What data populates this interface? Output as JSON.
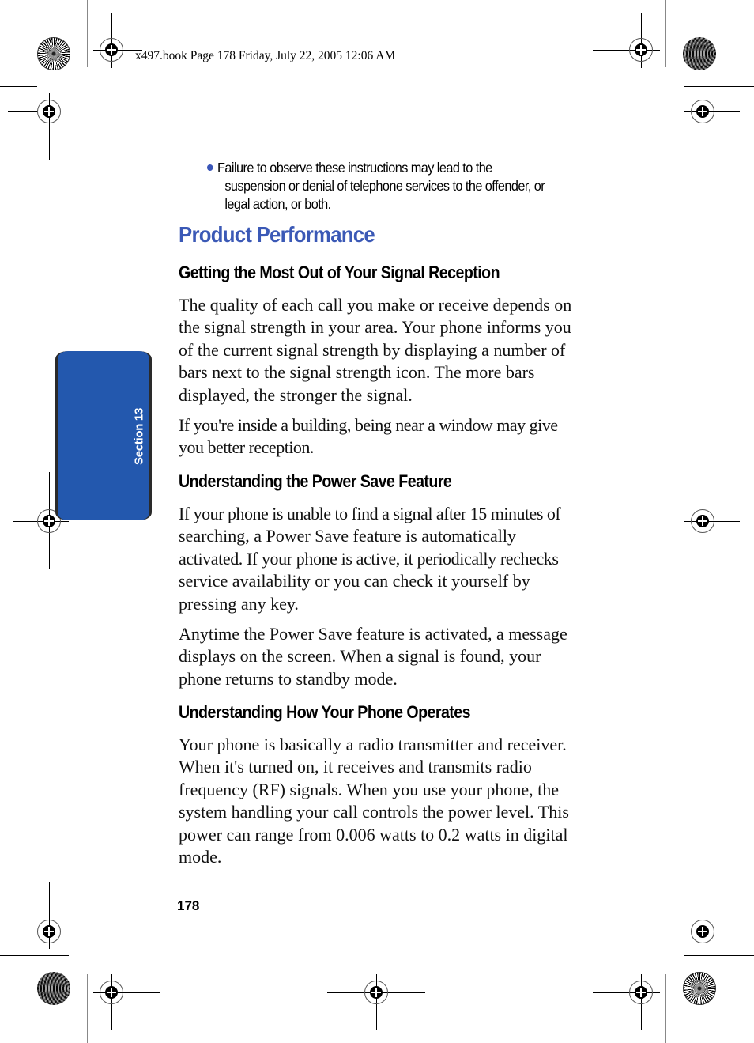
{
  "header": {
    "slug": "x497.book  Page 178  Friday, July 22, 2005  12:06 AM"
  },
  "section_tab": {
    "label": "Section 13",
    "color": "#2358ae"
  },
  "bullet": {
    "color": "#3a56b8",
    "lines": [
      "Failure to observe these instructions may lead to the",
      "suspension or denial of telephone services to the offender, or",
      "legal action, or both."
    ]
  },
  "title": {
    "text": "Product Performance",
    "color": "#3b59b6"
  },
  "sections": [
    {
      "heading": "Getting the Most Out of Your Signal Reception",
      "paragraphs": [
        {
          "lines": [
            "The quality of each call you make or receive depends on",
            "the signal strength in your area. Your phone informs you",
            "of the current signal strength by displaying a number of",
            "bars next to the signal strength icon. The more bars",
            "displayed, the stronger the signal."
          ]
        },
        {
          "lines": [
            "If you're inside a building, being near a window may give",
            "you better reception."
          ]
        }
      ]
    },
    {
      "heading": "Understanding the Power Save Feature",
      "paragraphs": [
        {
          "lines": [
            "If your phone is unable to find a signal after 15 minutes of",
            "searching, a Power Save feature is automatically",
            "activated. If your phone is active, it periodically rechecks",
            "service availability or you can check it yourself by",
            "pressing any key."
          ]
        },
        {
          "lines": [
            "Anytime the Power Save feature is activated, a message",
            "displays on the screen. When a signal is found, your",
            "phone returns to standby mode."
          ]
        }
      ]
    },
    {
      "heading": "Understanding How Your Phone Operates",
      "paragraphs": [
        {
          "lines": [
            "Your phone is basically a radio transmitter and receiver.",
            "When it's turned on, it receives and transmits radio",
            "frequency (RF) signals. When you use your phone, the",
            "system handling your call controls the power level. This",
            "power can range from 0.006 watts to 0.2 watts in digital",
            "mode."
          ]
        }
      ]
    }
  ],
  "footer": {
    "page_number": "178"
  }
}
